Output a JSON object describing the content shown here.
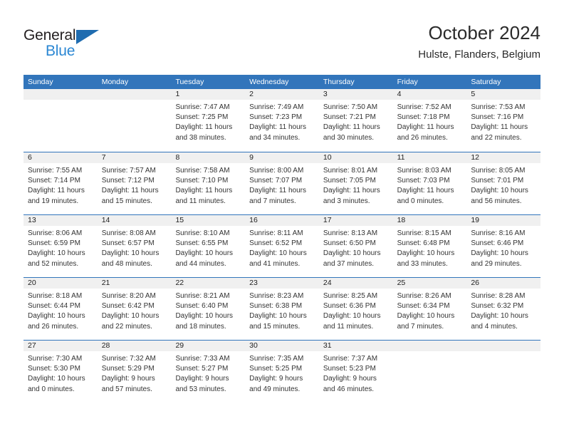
{
  "brand": {
    "name_part1": "General",
    "name_part2": "Blue",
    "triangle_icon": "triangle-icon",
    "color_dark": "#231f20",
    "color_blue": "#2b87d3"
  },
  "header": {
    "title": "October 2024",
    "subtitle": "Hulste, Flanders, Belgium"
  },
  "theme": {
    "header_blue": "#3275bb",
    "day_strip_gray": "#f0f0f0",
    "text": "#222222"
  },
  "weekdays": [
    "Sunday",
    "Monday",
    "Tuesday",
    "Wednesday",
    "Thursday",
    "Friday",
    "Saturday"
  ],
  "weeks": [
    [
      {
        "day": "",
        "lines": []
      },
      {
        "day": "",
        "lines": []
      },
      {
        "day": "1",
        "lines": [
          "Sunrise: 7:47 AM",
          "Sunset: 7:25 PM",
          "Daylight: 11 hours",
          "and 38 minutes."
        ]
      },
      {
        "day": "2",
        "lines": [
          "Sunrise: 7:49 AM",
          "Sunset: 7:23 PM",
          "Daylight: 11 hours",
          "and 34 minutes."
        ]
      },
      {
        "day": "3",
        "lines": [
          "Sunrise: 7:50 AM",
          "Sunset: 7:21 PM",
          "Daylight: 11 hours",
          "and 30 minutes."
        ]
      },
      {
        "day": "4",
        "lines": [
          "Sunrise: 7:52 AM",
          "Sunset: 7:18 PM",
          "Daylight: 11 hours",
          "and 26 minutes."
        ]
      },
      {
        "day": "5",
        "lines": [
          "Sunrise: 7:53 AM",
          "Sunset: 7:16 PM",
          "Daylight: 11 hours",
          "and 22 minutes."
        ]
      }
    ],
    [
      {
        "day": "6",
        "lines": [
          "Sunrise: 7:55 AM",
          "Sunset: 7:14 PM",
          "Daylight: 11 hours",
          "and 19 minutes."
        ]
      },
      {
        "day": "7",
        "lines": [
          "Sunrise: 7:57 AM",
          "Sunset: 7:12 PM",
          "Daylight: 11 hours",
          "and 15 minutes."
        ]
      },
      {
        "day": "8",
        "lines": [
          "Sunrise: 7:58 AM",
          "Sunset: 7:10 PM",
          "Daylight: 11 hours",
          "and 11 minutes."
        ]
      },
      {
        "day": "9",
        "lines": [
          "Sunrise: 8:00 AM",
          "Sunset: 7:07 PM",
          "Daylight: 11 hours",
          "and 7 minutes."
        ]
      },
      {
        "day": "10",
        "lines": [
          "Sunrise: 8:01 AM",
          "Sunset: 7:05 PM",
          "Daylight: 11 hours",
          "and 3 minutes."
        ]
      },
      {
        "day": "11",
        "lines": [
          "Sunrise: 8:03 AM",
          "Sunset: 7:03 PM",
          "Daylight: 11 hours",
          "and 0 minutes."
        ]
      },
      {
        "day": "12",
        "lines": [
          "Sunrise: 8:05 AM",
          "Sunset: 7:01 PM",
          "Daylight: 10 hours",
          "and 56 minutes."
        ]
      }
    ],
    [
      {
        "day": "13",
        "lines": [
          "Sunrise: 8:06 AM",
          "Sunset: 6:59 PM",
          "Daylight: 10 hours",
          "and 52 minutes."
        ]
      },
      {
        "day": "14",
        "lines": [
          "Sunrise: 8:08 AM",
          "Sunset: 6:57 PM",
          "Daylight: 10 hours",
          "and 48 minutes."
        ]
      },
      {
        "day": "15",
        "lines": [
          "Sunrise: 8:10 AM",
          "Sunset: 6:55 PM",
          "Daylight: 10 hours",
          "and 44 minutes."
        ]
      },
      {
        "day": "16",
        "lines": [
          "Sunrise: 8:11 AM",
          "Sunset: 6:52 PM",
          "Daylight: 10 hours",
          "and 41 minutes."
        ]
      },
      {
        "day": "17",
        "lines": [
          "Sunrise: 8:13 AM",
          "Sunset: 6:50 PM",
          "Daylight: 10 hours",
          "and 37 minutes."
        ]
      },
      {
        "day": "18",
        "lines": [
          "Sunrise: 8:15 AM",
          "Sunset: 6:48 PM",
          "Daylight: 10 hours",
          "and 33 minutes."
        ]
      },
      {
        "day": "19",
        "lines": [
          "Sunrise: 8:16 AM",
          "Sunset: 6:46 PM",
          "Daylight: 10 hours",
          "and 29 minutes."
        ]
      }
    ],
    [
      {
        "day": "20",
        "lines": [
          "Sunrise: 8:18 AM",
          "Sunset: 6:44 PM",
          "Daylight: 10 hours",
          "and 26 minutes."
        ]
      },
      {
        "day": "21",
        "lines": [
          "Sunrise: 8:20 AM",
          "Sunset: 6:42 PM",
          "Daylight: 10 hours",
          "and 22 minutes."
        ]
      },
      {
        "day": "22",
        "lines": [
          "Sunrise: 8:21 AM",
          "Sunset: 6:40 PM",
          "Daylight: 10 hours",
          "and 18 minutes."
        ]
      },
      {
        "day": "23",
        "lines": [
          "Sunrise: 8:23 AM",
          "Sunset: 6:38 PM",
          "Daylight: 10 hours",
          "and 15 minutes."
        ]
      },
      {
        "day": "24",
        "lines": [
          "Sunrise: 8:25 AM",
          "Sunset: 6:36 PM",
          "Daylight: 10 hours",
          "and 11 minutes."
        ]
      },
      {
        "day": "25",
        "lines": [
          "Sunrise: 8:26 AM",
          "Sunset: 6:34 PM",
          "Daylight: 10 hours",
          "and 7 minutes."
        ]
      },
      {
        "day": "26",
        "lines": [
          "Sunrise: 8:28 AM",
          "Sunset: 6:32 PM",
          "Daylight: 10 hours",
          "and 4 minutes."
        ]
      }
    ],
    [
      {
        "day": "27",
        "lines": [
          "Sunrise: 7:30 AM",
          "Sunset: 5:30 PM",
          "Daylight: 10 hours",
          "and 0 minutes."
        ]
      },
      {
        "day": "28",
        "lines": [
          "Sunrise: 7:32 AM",
          "Sunset: 5:29 PM",
          "Daylight: 9 hours",
          "and 57 minutes."
        ]
      },
      {
        "day": "29",
        "lines": [
          "Sunrise: 7:33 AM",
          "Sunset: 5:27 PM",
          "Daylight: 9 hours",
          "and 53 minutes."
        ]
      },
      {
        "day": "30",
        "lines": [
          "Sunrise: 7:35 AM",
          "Sunset: 5:25 PM",
          "Daylight: 9 hours",
          "and 49 minutes."
        ]
      },
      {
        "day": "31",
        "lines": [
          "Sunrise: 7:37 AM",
          "Sunset: 5:23 PM",
          "Daylight: 9 hours",
          "and 46 minutes."
        ]
      },
      {
        "day": "",
        "lines": []
      },
      {
        "day": "",
        "lines": []
      }
    ]
  ]
}
